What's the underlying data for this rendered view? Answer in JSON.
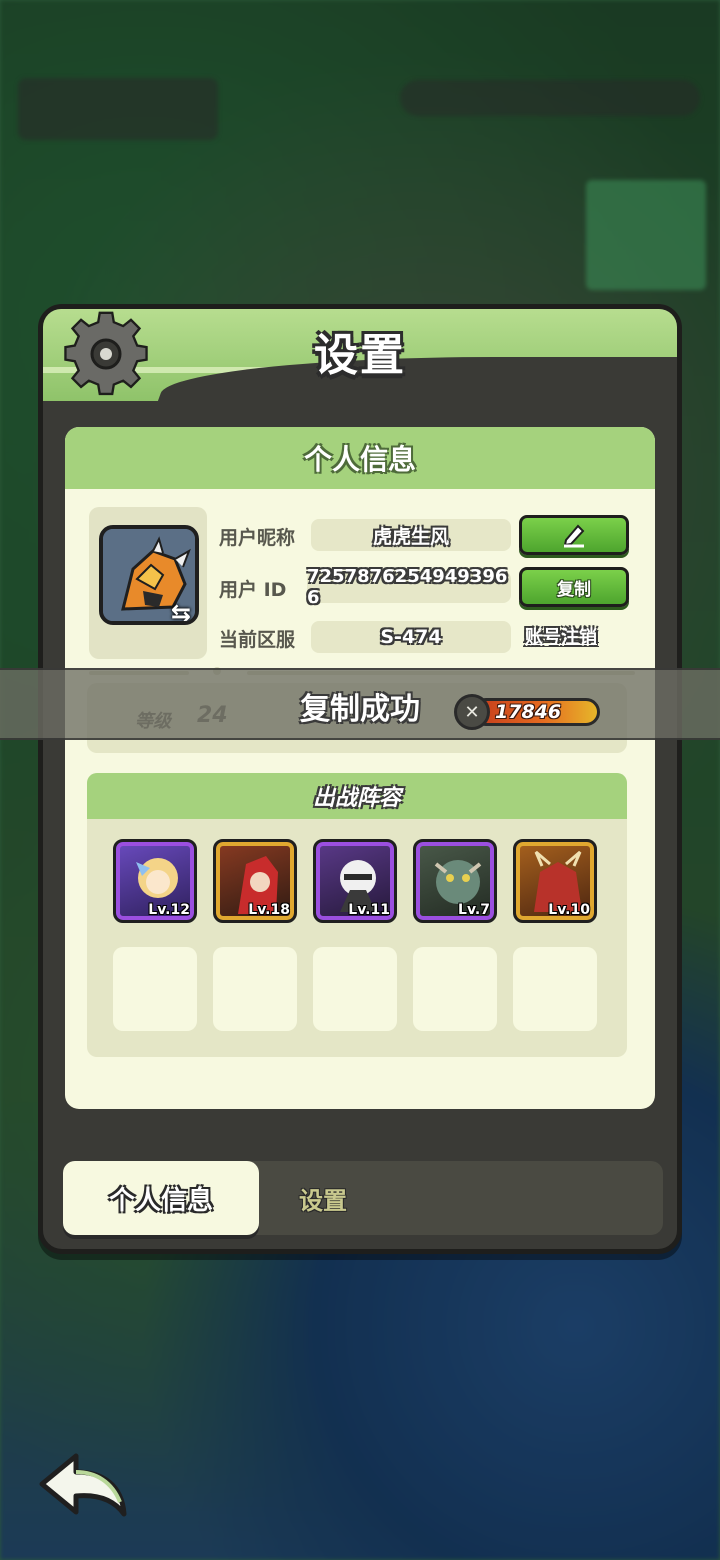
{
  "panel": {
    "title": "设置"
  },
  "profile_section": {
    "header": "个人信息",
    "nickname_label": "用户昵称",
    "nickname_value": "虎虎生风",
    "id_label": "用户 ID",
    "id_value": "7257876254949396​6",
    "server_label": "当前区服",
    "server_value": "S-474",
    "copy_button": "复制",
    "cancel_account_link": "账号注销",
    "level_label": "等级",
    "level_value": "24",
    "power_value": "17846"
  },
  "toast": {
    "message": "复制成功"
  },
  "lineup": {
    "header": "出战阵容",
    "heroes": [
      {
        "level": "Lv.12",
        "rarity": "purple"
      },
      {
        "level": "Lv.18",
        "rarity": "gold"
      },
      {
        "level": "Lv.11",
        "rarity": "purple"
      },
      {
        "level": "Lv.7",
        "rarity": "purple"
      },
      {
        "level": "Lv.10",
        "rarity": "gold"
      }
    ],
    "empty_slots": 5
  },
  "tabs": {
    "active": "个人信息",
    "inactive": "设置"
  },
  "icons": {
    "settings": "gear-icon",
    "edit": "pencil-icon",
    "back": "back-arrow-icon",
    "swap": "swap-icon",
    "power": "sword-icon"
  },
  "colors": {
    "accent_green": "#a5d27d",
    "button_green": "#4ea52e",
    "card_bg": "#f7f9e0"
  }
}
